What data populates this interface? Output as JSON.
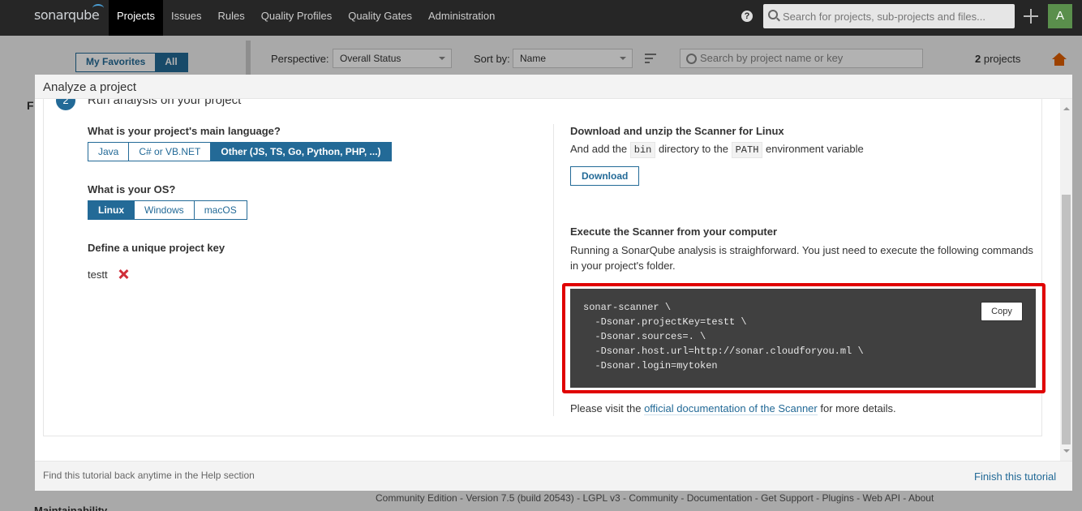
{
  "topbar": {
    "logo_text": "sonarqube",
    "nav": [
      "Projects",
      "Issues",
      "Rules",
      "Quality Profiles",
      "Quality Gates",
      "Administration"
    ],
    "help_glyph": "?",
    "search_placeholder": "Search for projects, sub-projects and files...",
    "avatar_letter": "A"
  },
  "projects_page": {
    "favorites": "My Favorites",
    "all": "All",
    "perspective_label": "Perspective:",
    "perspective_value": "Overall Status",
    "sort_label": "Sort by:",
    "sort_value": "Name",
    "search_placeholder": "Search by project name or key",
    "count": "2",
    "count_label": "projects",
    "filter_letter": "F",
    "maintainability_label": "Maintainability"
  },
  "footer_text": "Community Edition - Version 7.5 (build 20543) - LGPL v3 - Community - Documentation - Get Support - Plugins - Web API - About",
  "modal": {
    "title": "Analyze a project",
    "step_number": "2",
    "step_title": "Run analysis on your project",
    "language_question": "What is your project's main language?",
    "languages": [
      "Java",
      "C# or VB.NET",
      "Other (JS, TS, Go, Python, PHP, ...)"
    ],
    "selected_language": "Other (JS, TS, Go, Python, PHP, ...)",
    "os_question": "What is your OS?",
    "os_options": [
      "Linux",
      "Windows",
      "macOS"
    ],
    "selected_os": "Linux",
    "key_question": "Define a unique project key",
    "project_key": "testt",
    "download_title": "Download and unzip the Scanner for Linux",
    "add_text_1": "And add the",
    "bin_code": "bin",
    "add_text_2": "directory to the",
    "path_code": "PATH",
    "add_text_3": "environment variable",
    "download_button": "Download",
    "execute_title": "Execute the Scanner from your computer",
    "execute_text": "Running a SonarQube analysis is straighforward. You just need to execute the following commands in your project's folder.",
    "code": "sonar-scanner \\\n  -Dsonar.projectKey=testt \\\n  -Dsonar.sources=. \\\n  -Dsonar.host.url=http://sonar.cloudforyou.ml \\\n  -Dsonar.login=mytoken",
    "copy_button": "Copy",
    "visit_prefix": "Please visit the",
    "visit_link": "official documentation of the Scanner",
    "visit_suffix": "for more details.",
    "help_note": "Find this tutorial back anytime in the Help section",
    "finish_link": "Finish this tutorial"
  },
  "colors": {
    "brand_blue": "#236a97",
    "highlight_red": "#e00000",
    "topbar": "#262626"
  }
}
